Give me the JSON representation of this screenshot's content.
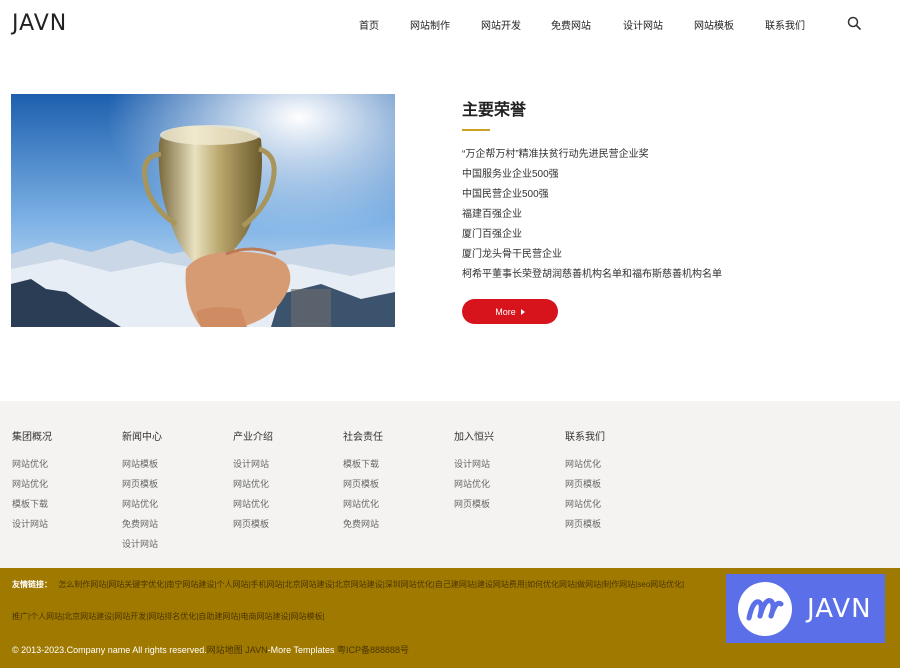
{
  "header": {
    "logo": "JAVN",
    "nav": [
      "首页",
      "网站制作",
      "网站开发",
      "免费网站",
      "设计网站",
      "网站模板",
      "联系我们"
    ]
  },
  "honors": {
    "title": "主要荣誉",
    "items": [
      "“万企帮万村”精准扶贫行动先进民营企业奖",
      "中国服务业企业500强",
      "中国民营企业500强",
      "福建百强企业",
      "厦门百强企业",
      "厦门龙头骨干民营企业",
      "柯希平董事长荣登胡润慈善机构名单和福布斯慈善机构名单"
    ],
    "more_label": "More"
  },
  "footer": {
    "columns": [
      {
        "title": "集团概况",
        "links": [
          "网站优化",
          "网站优化",
          "模板下载",
          "设计网站"
        ]
      },
      {
        "title": "新闻中心",
        "links": [
          "网站模板",
          "网页模板",
          "网站优化",
          "免费网站",
          "设计网站"
        ]
      },
      {
        "title": "产业介绍",
        "links": [
          "设计网站",
          "网站优化",
          "网站优化",
          "网页模板"
        ]
      },
      {
        "title": "社会责任",
        "links": [
          "模板下载",
          "网页模板",
          "网站优化",
          "免费网站"
        ]
      },
      {
        "title": "加入恒兴",
        "links": [
          "设计网站",
          "网站优化",
          "网页模板"
        ]
      },
      {
        "title": "联系我们",
        "links": [
          "网站优化",
          "网页模板",
          "网站优化",
          "网页模板"
        ]
      }
    ]
  },
  "friend_links": {
    "label": "友情链接：",
    "row1": [
      "怎么制作网站",
      "网站关键字优化",
      "南宁网站建设",
      "个人网站",
      "手机网站",
      "北京网站建设",
      "北京网站建设",
      "深圳网站优化",
      "自己建网站",
      "建设网站费用",
      "如何优化网站",
      "做网站",
      "制作网站",
      "seo网站优化"
    ],
    "row2": [
      "推广",
      "个人网站",
      "北京网站建设",
      "网站开发",
      "网站排名优化",
      "自助建网站",
      "电商网站建设",
      "网站模板"
    ]
  },
  "copyright": {
    "text": "© 2013-2023.Company name All rights reserved.",
    "sitemap": "网站地图",
    "brand": "JAVN",
    "templates": "-More Templates",
    "icp": "粤ICP备888888号"
  },
  "badge": {
    "text": "JAVN"
  },
  "colors": {
    "accent_red": "#d7131b",
    "gold_line": "#c9a227",
    "footer_gold": "#a07a00",
    "badge_blue": "#5b6fe8"
  },
  "icons": [
    "search-icon",
    "arrow-right-icon",
    "trophy-image",
    "javn-logo-icon"
  ]
}
